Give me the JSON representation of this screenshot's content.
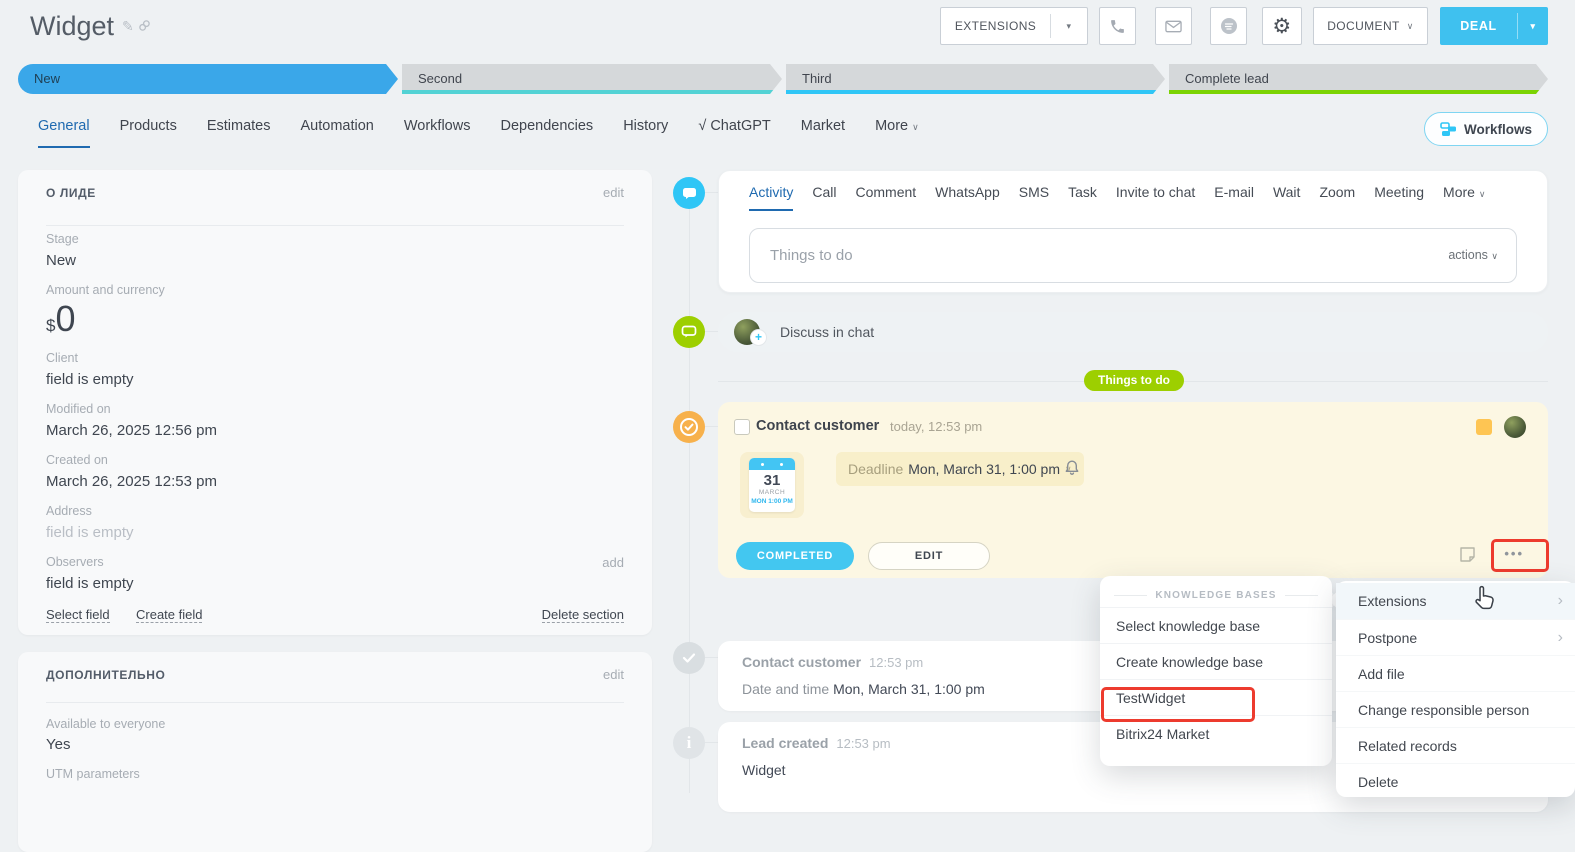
{
  "header": {
    "title": "Widget",
    "extensions_label": "EXTENSIONS",
    "document_label": "DOCUMENT",
    "deal_label": "DEAL"
  },
  "stages": [
    {
      "label": "New",
      "state": "active"
    },
    {
      "label": "Second",
      "strip_color": "#52d2d4"
    },
    {
      "label": "Third",
      "strip_color": "#2fc6f6"
    },
    {
      "label": "Complete lead",
      "strip_color": "#7bd303"
    }
  ],
  "main_tabs": [
    "General",
    "Products",
    "Estimates",
    "Automation",
    "Workflows",
    "Dependencies",
    "History",
    "ChatGPT",
    "Market",
    "More"
  ],
  "workflows_pill": "Workflows",
  "about": {
    "section_title": "О ЛИДЕ",
    "edit_label": "edit",
    "fields": [
      {
        "label": "Stage",
        "value": "New"
      },
      {
        "label": "Amount and currency",
        "currency": "$",
        "amount": "0"
      },
      {
        "label": "Client",
        "value": "field is empty"
      },
      {
        "label": "Modified on",
        "value": "March 26, 2025 12:56 pm"
      },
      {
        "label": "Created on",
        "value": "March 26, 2025 12:53 pm"
      },
      {
        "label": "Address",
        "value": "field is empty"
      },
      {
        "label": "Observers",
        "value": "field is empty",
        "action": "add"
      }
    ],
    "select_field": "Select field",
    "create_field": "Create field",
    "delete_section": "Delete section"
  },
  "additional": {
    "section_title": "ДОПОЛНИТЕЛЬНО",
    "edit_label": "edit",
    "fields": [
      {
        "label": "Available to everyone",
        "value": "Yes"
      },
      {
        "label": "UTM parameters",
        "value": ""
      }
    ]
  },
  "timeline": {
    "tabs": [
      "Activity",
      "Call",
      "Comment",
      "WhatsApp",
      "SMS",
      "Task",
      "Invite to chat",
      "E-mail",
      "Wait",
      "Zoom",
      "Meeting",
      "More"
    ],
    "todo_placeholder": "Things to do",
    "actions_label": "actions",
    "discuss_label": "Discuss in chat",
    "badge_label": "Things to do",
    "task": {
      "title": "Contact customer",
      "time": "today, 12:53 pm",
      "calendar": {
        "day": "31",
        "month": "MARCH",
        "sub": "MON 1:00 PM"
      },
      "deadline_label": "Deadline",
      "deadline_value": "Mon, March 31, 1:00 pm",
      "completed_label": "COMPLETED",
      "edit_label": "EDIT"
    },
    "history": [
      {
        "title": "Contact customer",
        "time": "12:53 pm",
        "line_label": "Date and time",
        "line_value": "Mon, March 31, 1:00 pm"
      },
      {
        "title": "Lead created",
        "time": "12:53 pm",
        "line_value": "Widget"
      }
    ]
  },
  "menus": {
    "knowledge": {
      "header": "KNOWLEDGE BASES",
      "items": [
        "Select knowledge base",
        "Create knowledge base",
        "TestWidget",
        "Bitrix24 Market"
      ]
    },
    "context": {
      "items": [
        "Extensions",
        "Postpone",
        "Add file",
        "Change responsible person",
        "Related records",
        "Delete"
      ]
    }
  },
  "icons": {
    "edit_pencil": "✎",
    "chevron_down": "∨",
    "caret_down": "▾",
    "more_dots": "•••",
    "check": "√",
    "submenu_arrow": "›",
    "plus": "+",
    "info": "i",
    "gear": "⚙"
  },
  "colors": {
    "accent_blue": "#2fc6f6",
    "deal_button_blue": "#3fc1ef",
    "active_tab_blue": "#1f6ab0",
    "stage_active_blue": "#3aa7e9",
    "green": "#9dcf00",
    "task_orange": "#f7a94c",
    "task_card_bg": "#fcf7e3",
    "annotation_red": "#ed3b2e"
  }
}
